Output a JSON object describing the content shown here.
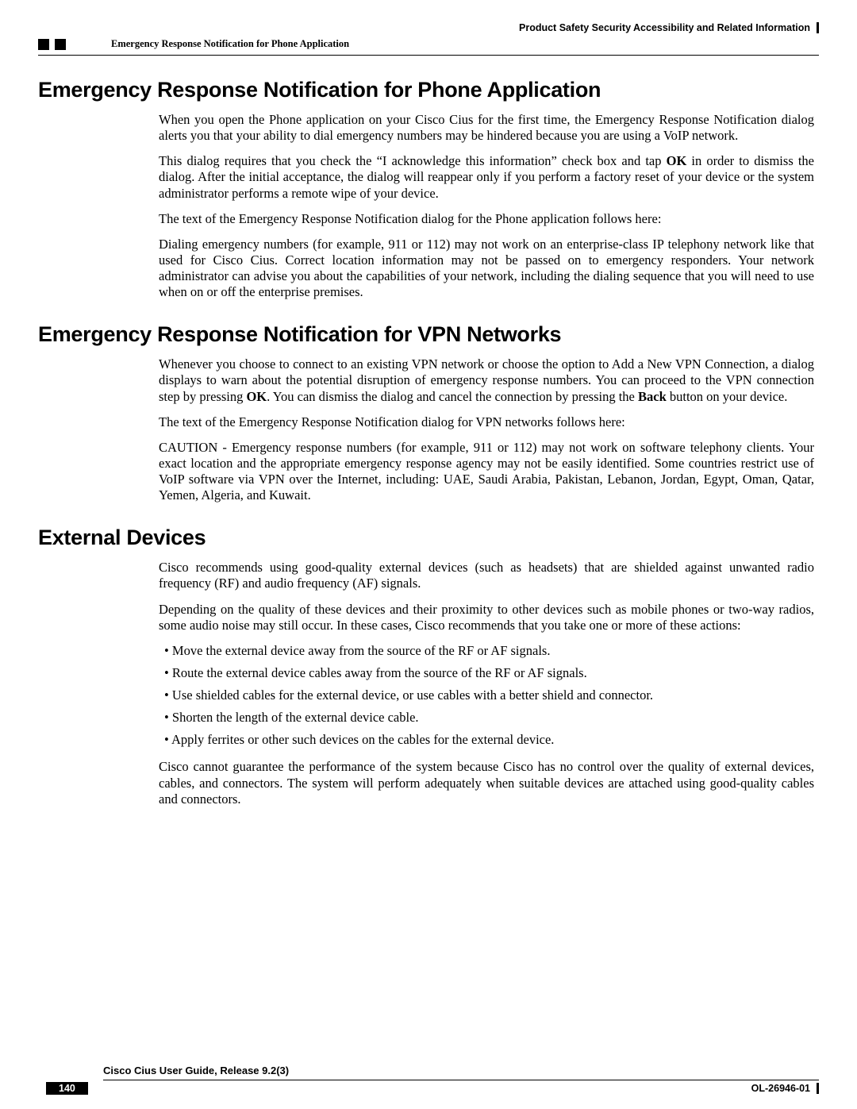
{
  "header": {
    "chapter_title": "Product Safety Security Accessibility and Related Information",
    "section_title": "Emergency Response Notification for Phone Application"
  },
  "sections": {
    "phone": {
      "heading": "Emergency Response Notification for Phone Application",
      "p1": "When you open the Phone application on your Cisco Cius for the first time, the Emergency Response Notification dialog alerts you that your ability to dial emergency numbers may be hindered because you are using a VoIP network.",
      "p2a": "This dialog requires that you check the “I acknowledge this information” check box and tap ",
      "p2b": "OK",
      "p2c": " in order to dismiss the dialog. After the initial acceptance, the dialog will reappear only if you perform a factory reset of your device or the system administrator performs a remote wipe of your device.",
      "p3": "The text of the Emergency Response Notification dialog for the Phone application follows here:",
      "p4": "Dialing emergency numbers (for example, 911 or 112) may not work on an enterprise-class IP telephony network like that used for Cisco Cius. Correct location information may not be passed on to emergency responders. Your network administrator can advise you about the capabilities of your network, including the dialing sequence that you will need to use when on or off the enterprise premises."
    },
    "vpn": {
      "heading": "Emergency Response Notification for VPN Networks",
      "p1a": "Whenever you choose to connect to an existing VPN network or choose the option to Add a New VPN Connection, a dialog displays to warn about the potential disruption of emergency response numbers. You can proceed to the VPN connection step by pressing ",
      "p1b": "OK",
      "p1c": ". You can dismiss the dialog and cancel the connection by pressing the ",
      "p1d": "Back",
      "p1e": " button on your device.",
      "p2": "The text of the Emergency Response Notification dialog for VPN networks follows here:",
      "p3": "CAUTION - Emergency response numbers (for example, 911 or 112) may not work on software telephony clients. Your exact location and the appropriate emergency response agency may not be easily identified. Some countries restrict use of VoIP software via VPN over the Internet, including: UAE, Saudi Arabia, Pakistan, Lebanon, Jordan, Egypt, Oman, Qatar, Yemen, Algeria, and Kuwait."
    },
    "ext": {
      "heading": "External Devices",
      "p1": "Cisco recommends using good-quality external devices (such as headsets) that are shielded against unwanted radio frequency (RF) and audio frequency (AF) signals.",
      "p2": "Depending on the quality of these devices and their proximity to other devices such as mobile phones or two-way radios, some audio noise may still occur. In these cases, Cisco recommends that you take one or more of these actions:",
      "bullets": [
        "Move the external device away from the source of the RF or AF signals.",
        "Route the external device cables away from the source of the RF or AF signals.",
        "Use shielded cables for the external device, or use cables with a better shield and connector.",
        "Shorten the length of the external device cable.",
        "Apply ferrites or other such devices on the cables for the external device."
      ],
      "p3": "Cisco cannot guarantee the performance of the system because Cisco has no control over the quality of external devices, cables, and connectors. The system will perform adequately when suitable devices are attached using good-quality cables and connectors."
    }
  },
  "footer": {
    "guide_title": "Cisco Cius User Guide, Release 9.2(3)",
    "page_number": "140",
    "doc_id": "OL-26946-01"
  }
}
